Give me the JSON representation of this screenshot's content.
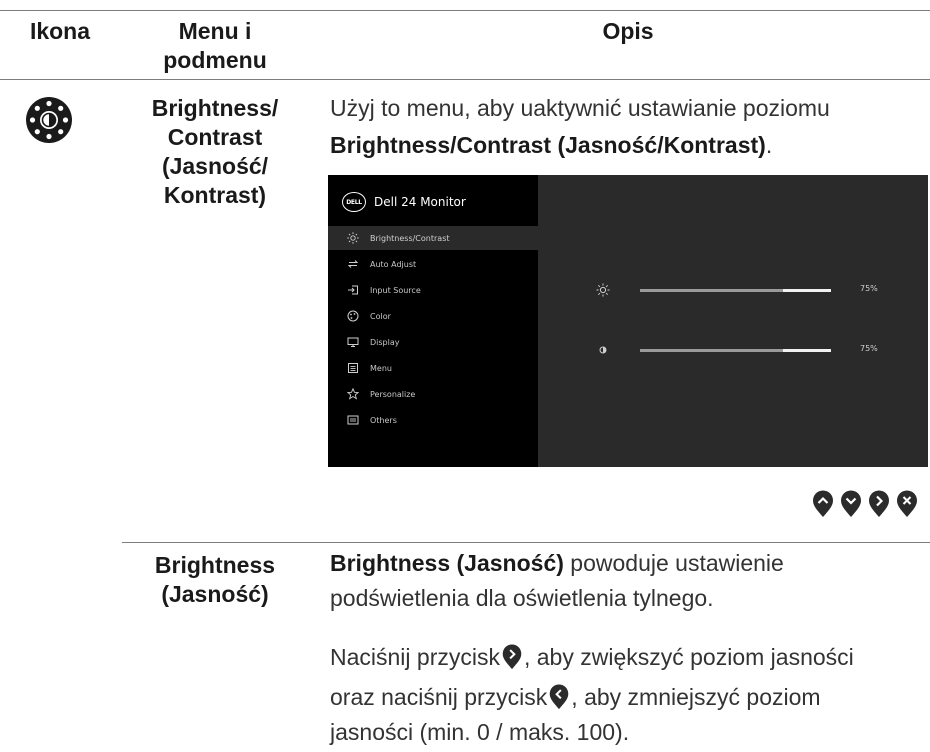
{
  "headers": {
    "icon": "Ikona",
    "menu_line1": "Menu i",
    "menu_line2": "podmenu",
    "desc": "Opis"
  },
  "row1": {
    "icon": "brightness-icon",
    "menu_lines": [
      "Brightness/",
      "Contrast",
      "(Jasność/",
      "Kontrast)"
    ],
    "desc_plain1": "Użyj to menu, aby uaktywnić ustawianie poziomu",
    "desc_bold": "Brightness/Contrast (Jasność/Kontrast)",
    "desc_end": "."
  },
  "osd": {
    "title": "Dell 24 Monitor",
    "logo": "DELL",
    "items": [
      {
        "label": "Brightness/Contrast",
        "icon": "sun-icon",
        "active": true
      },
      {
        "label": "Auto Adjust",
        "icon": "auto-adjust-icon",
        "active": false
      },
      {
        "label": "Input Source",
        "icon": "input-source-icon",
        "active": false
      },
      {
        "label": "Color",
        "icon": "color-icon",
        "active": false
      },
      {
        "label": "Display",
        "icon": "display-icon",
        "active": false
      },
      {
        "label": "Menu",
        "icon": "menu-icon",
        "active": false
      },
      {
        "label": "Personalize",
        "icon": "star-icon",
        "active": false
      },
      {
        "label": "Others",
        "icon": "others-icon",
        "active": false
      }
    ],
    "sliders": [
      {
        "name": "brightness",
        "icon": "sun-icon",
        "value": 75,
        "label": "75%"
      },
      {
        "name": "contrast",
        "icon": "contrast-icon",
        "value": 75,
        "label": "75%"
      }
    ]
  },
  "nav_buttons": [
    "up-button-icon",
    "down-button-icon",
    "right-button-icon",
    "close-button-icon"
  ],
  "row2": {
    "menu_lines": [
      "Brightness",
      "(Jasność)"
    ],
    "p1_bold": "Brightness (Jasność)",
    "p1_rest": " powoduje ustawienie",
    "p1_line2": "podświetlenia dla oświetlenia tylnego.",
    "p2_a": "Naciśnij przycisk",
    "p2_b": ", aby zwiększyć poziom jasności",
    "p3_a": "oraz naciśnij przycisk",
    "p3_b": ", aby zmniejszyć poziom",
    "p3_line2": "jasności (min. 0 / maks. 100)."
  },
  "colors": {
    "rule": "#7d7d7d",
    "osd_bg": "#000000",
    "osd_panel": "#2a2a2a",
    "button": "#2b2b2b"
  }
}
